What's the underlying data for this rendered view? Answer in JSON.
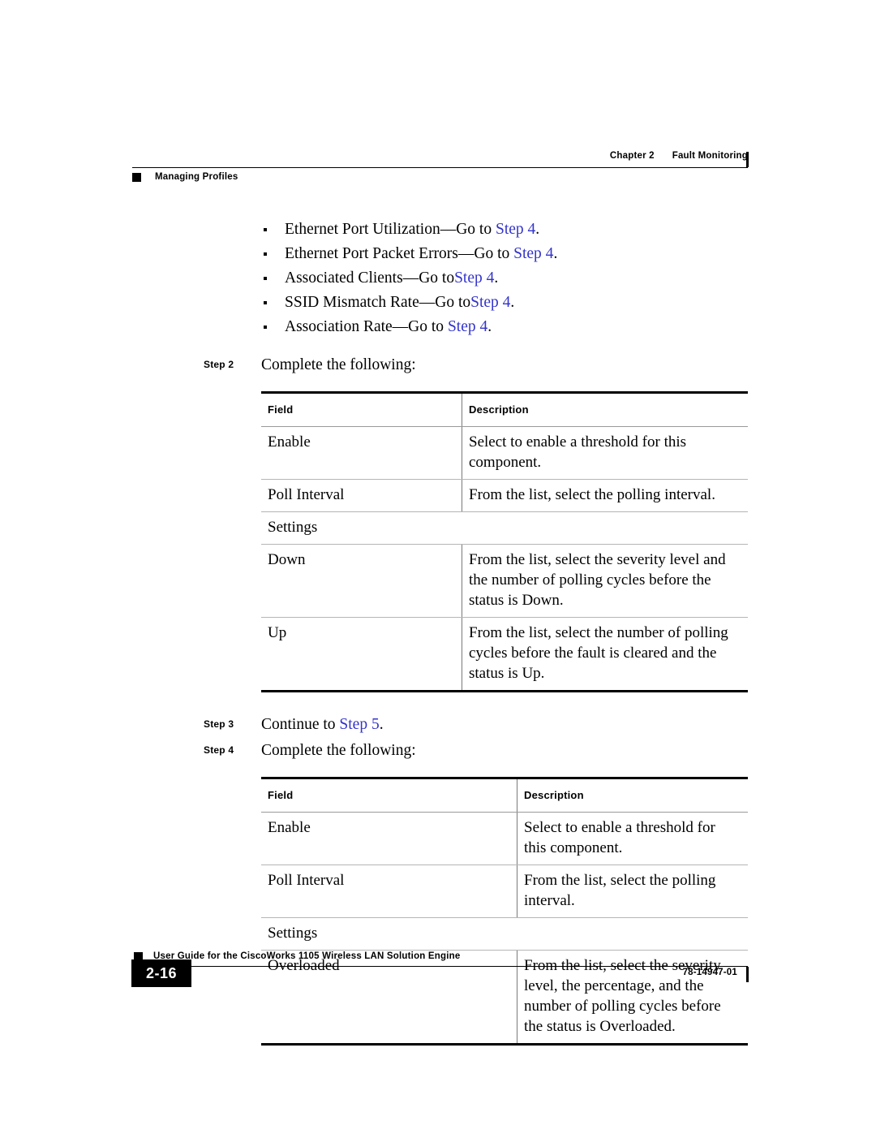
{
  "header": {
    "chapter": "Chapter 2",
    "chapter_title": "Fault Monitoring",
    "section": "Managing Profiles"
  },
  "body": {
    "bullets": [
      {
        "text": "Ethernet Port Utilization—Go to ",
        "link": "Step 4",
        "tail": "."
      },
      {
        "text": "Ethernet Port Packet Errors—Go to ",
        "link": "Step 4",
        "tail": "."
      },
      {
        "text": "Associated Clients—Go to",
        "link": "Step 4",
        "tail": "."
      },
      {
        "text": "SSID Mismatch Rate—Go to",
        "link": "Step 4",
        "tail": "."
      },
      {
        "text": "Association Rate—Go to ",
        "link": "Step 4",
        "tail": "."
      }
    ],
    "step2": {
      "label": "Step 2",
      "text": "Complete the following:"
    },
    "step3": {
      "label": "Step 3",
      "text_before": "Continue to ",
      "link": "Step 5",
      "text_after": "."
    },
    "step4": {
      "label": "Step 4",
      "text": "Complete the following:"
    }
  },
  "table1": {
    "headers": [
      "Field",
      "Description"
    ],
    "rows": [
      {
        "field": "Enable",
        "description": "Select to enable a threshold for this component.",
        "span": false
      },
      {
        "field": "Poll Interval",
        "description": "From the list, select the polling interval.",
        "span": false
      },
      {
        "field": "Settings",
        "description": "",
        "span": true
      },
      {
        "field": "Down",
        "description": "From the list, select the severity level and the number of polling cycles before the status is Down.",
        "span": false
      },
      {
        "field": "Up",
        "description": "From the list, select the number of polling cycles before the fault is cleared and the status is Up.",
        "span": false
      }
    ]
  },
  "table2": {
    "headers": [
      "Field",
      "Description"
    ],
    "rows": [
      {
        "field": "Enable",
        "description": "Select to enable a threshold for this component.",
        "span": false
      },
      {
        "field": "Poll Interval",
        "description": "From the list, select the polling interval.",
        "span": false
      },
      {
        "field": "Settings",
        "description": "",
        "span": true
      },
      {
        "field": "Overloaded",
        "description": "From the list, select the severity level, the percentage, and the number of polling cycles before the status is Overloaded.",
        "span": false
      }
    ]
  },
  "footer": {
    "title": "User Guide for the CiscoWorks 1105 Wireless LAN Solution Engine",
    "page_number": "2-16",
    "doc_number": "78-14947-01"
  },
  "colors": {
    "link": "#3333CC",
    "text": "#000000",
    "rule": "#000000"
  }
}
